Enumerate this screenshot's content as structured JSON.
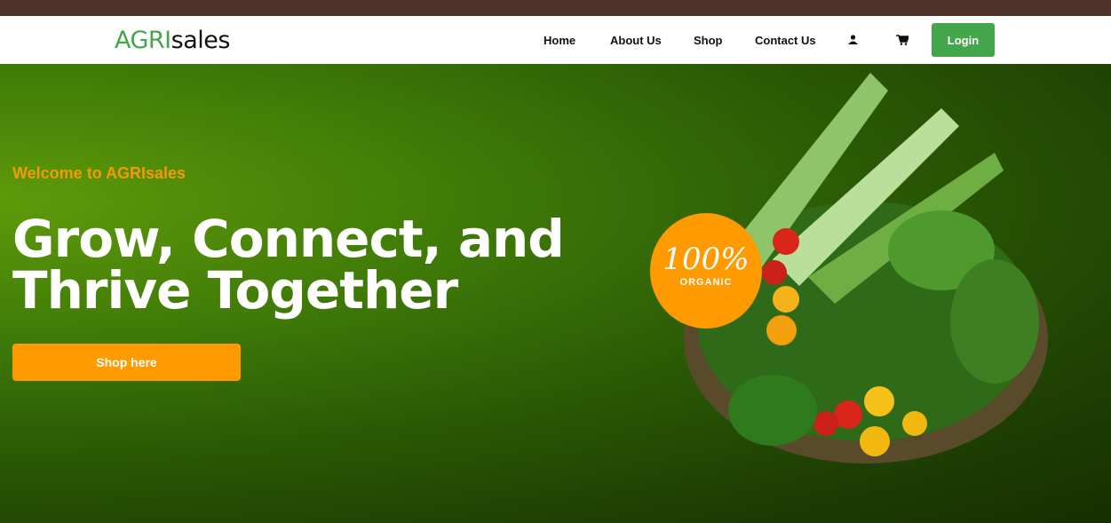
{
  "logo": {
    "part1": "AGRI",
    "part2": "sales"
  },
  "nav": {
    "items": [
      "Home",
      "About Us",
      "Shop",
      "Contact Us"
    ],
    "login": "Login"
  },
  "hero": {
    "welcome": "Welcome to AGRIsales",
    "headline_line1": "Grow, Connect, and",
    "headline_line2": "Thrive Together",
    "cta": "Shop here"
  },
  "badge": {
    "percent": "100%",
    "label": "ORGANIC"
  },
  "colors": {
    "brand": "#43a64a",
    "accent": "#ff9a00"
  }
}
